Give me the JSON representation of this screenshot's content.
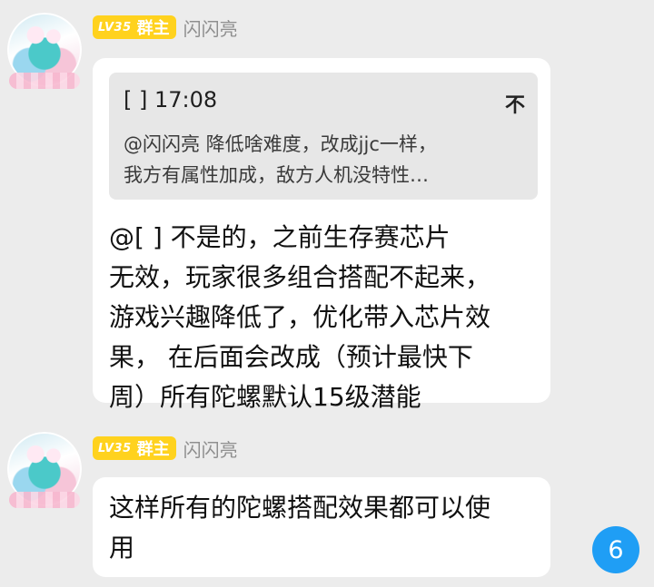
{
  "messages": [
    {
      "level": "LV35",
      "role": "群主",
      "sender": "闪闪亮",
      "quote": {
        "header": "[      ] 17:08",
        "pin_glyph": "不",
        "lines": [
          "@闪闪亮 降低啥难度，改成jjc一样，",
          "我方有属性加成，敌方人机没特性…"
        ]
      },
      "body": [
        "@[      ] 不是的，之前生存赛芯片",
        "无效，玩家很多组合搭配不起来，",
        "游戏兴趣降低了，优化带入芯片效",
        "果， 在后面会改成（预计最快下",
        "周）所有陀螺默认15级潜能"
      ]
    },
    {
      "level": "LV35",
      "role": "群主",
      "sender": "闪闪亮",
      "body": [
        "这样所有的陀螺搭配效果都可以使",
        "用"
      ]
    }
  ],
  "unread_count": "6",
  "colors": {
    "background": "#ececec",
    "bubble": "#ffffff",
    "quote_bg": "#e7e7e7",
    "badge": "#ffd21e",
    "unread_badge": "#1f9ef5"
  }
}
